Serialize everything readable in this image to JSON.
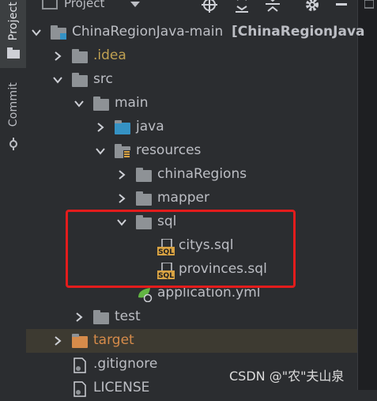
{
  "toolbar": {
    "title": "Project"
  },
  "left_tabs": {
    "project": "Project",
    "commit": "Commit"
  },
  "tree": [
    {
      "label": "ChinaRegionJava-main",
      "suffix": "[ChinaRegionJava",
      "kind": "module",
      "depth": 0,
      "expanded": true
    },
    {
      "label": ".idea",
      "kind": "folder",
      "depth": 1,
      "expanded": false,
      "color": "#c0a152"
    },
    {
      "label": "src",
      "kind": "folder",
      "depth": 1,
      "expanded": true
    },
    {
      "label": "main",
      "kind": "folder",
      "depth": 2,
      "expanded": true
    },
    {
      "label": "java",
      "kind": "folder-src",
      "depth": 3,
      "expanded": false
    },
    {
      "label": "resources",
      "kind": "folder-res",
      "depth": 3,
      "expanded": true
    },
    {
      "label": "chinaRegions",
      "kind": "folder",
      "depth": 4,
      "expanded": false
    },
    {
      "label": "mapper",
      "kind": "folder",
      "depth": 4,
      "expanded": false
    },
    {
      "label": "sql",
      "kind": "folder",
      "depth": 4,
      "expanded": true
    },
    {
      "label": "citys.sql",
      "kind": "sql",
      "depth": 5
    },
    {
      "label": "provinces.sql",
      "kind": "sql",
      "depth": 5
    },
    {
      "label": "application.yml",
      "kind": "yml",
      "depth": 4
    },
    {
      "label": "test",
      "kind": "folder",
      "depth": 2,
      "expanded": false
    },
    {
      "label": "target",
      "kind": "folder-excluded",
      "depth": 1,
      "expanded": false,
      "color": "#d68b4a"
    },
    {
      "label": ".gitignore",
      "kind": "file",
      "depth": 1
    },
    {
      "label": "LICENSE",
      "kind": "file",
      "depth": 1
    }
  ],
  "watermark": "CSDN @\"农\"夫山泉",
  "colors": {
    "accent": "#e31c1c",
    "folder": "#8e9296",
    "text": "#bcbec4"
  }
}
